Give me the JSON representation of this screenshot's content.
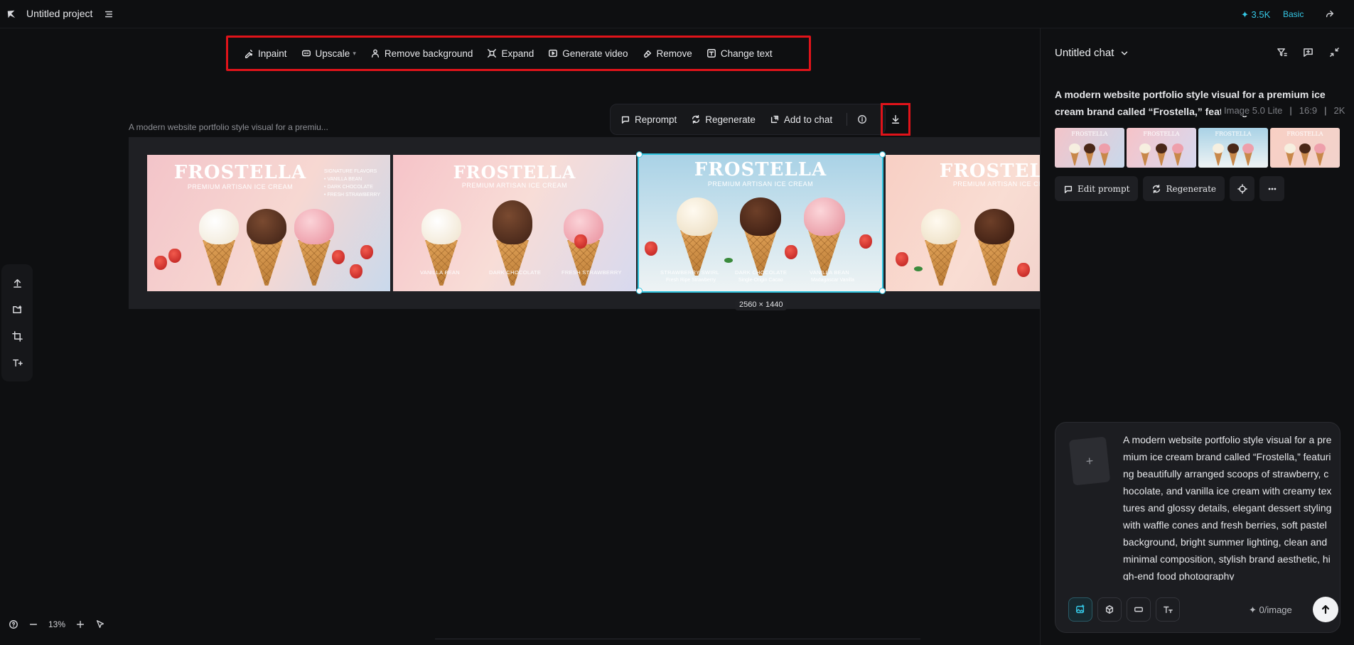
{
  "header": {
    "project_title": "Untitled project",
    "credits": "✦ 3.5K",
    "plan": "Basic"
  },
  "toolbar": {
    "items": [
      {
        "label": "Inpaint",
        "icon": "inpaint-icon"
      },
      {
        "label": "Upscale",
        "icon": "upscale-icon"
      },
      {
        "label": "Remove background",
        "icon": "person-icon"
      },
      {
        "label": "Expand",
        "icon": "expand-icon"
      },
      {
        "label": "Generate video",
        "icon": "video-icon"
      },
      {
        "label": "Remove",
        "icon": "eraser-icon"
      },
      {
        "label": "Change text",
        "icon": "text-icon"
      }
    ]
  },
  "image_actions": {
    "reprompt": "Reprompt",
    "regenerate": "Regenerate",
    "add_to_chat": "Add to chat"
  },
  "canvas": {
    "caption": "A modern website portfolio style visual for a premiu...",
    "dimensions": "2560 × 1440",
    "zoom": "13%",
    "images": [
      {
        "title": "FROSTELLA",
        "subtitle": "PREMIUM ARTISAN ICE CREAM",
        "signature": [
          "SIGNATURE FLAVORS",
          "• VANILLA BEAN",
          "• DARK CHOCOLATE",
          "• FRESH STRAWBERRY"
        ]
      },
      {
        "title": "FROSTELLA",
        "subtitle": "PREMIUM ARTISAN ICE CREAM",
        "flavors": [
          "VANILLA BEAN",
          "DARK CHOCOLATE",
          "FRESH STRAWBERRY"
        ]
      },
      {
        "title": "FROSTELLA",
        "subtitle": "PREMIUM ARTISAN ICE CREAM",
        "flavors": [
          "STRAWBERRY SWIRL",
          "DARK CHOCOLATE",
          "VANILLA BEAN"
        ],
        "details": [
          "Fresh Ripe Strawberry",
          "Single-Origin Cacao",
          "Madagascar Vanilla"
        ]
      },
      {
        "title": "FROSTELLA",
        "subtitle": "PREMIUM ARTISAN ICE CREAM"
      }
    ]
  },
  "chat": {
    "title": "Untitled chat",
    "prompt_preview": "A modern website portfolio style visual for a premium ice cream brand called “Frostella,” featuring",
    "model": "Image 5.0 Lite",
    "ratio": "16:9",
    "resolution": "2K",
    "thumb_label": "FROSTELLA",
    "edit_prompt": "Edit prompt",
    "regenerate": "Regenerate",
    "composer_text": "A modern website portfolio style visual for a premium ice cream brand called “Frostella,” featuring beautifully arranged scoops of strawberry, chocolate, and vanilla ice cream with creamy textures and glossy details, elegant dessert styling with waffle cones and fresh berries, soft pastel background, bright summer lighting, clean and minimal composition, stylish brand aesthetic, high-end food photography",
    "cost": "✦ 0/image"
  },
  "colors": {
    "accent": "#35c8e6",
    "highlight_box": "#e0131a",
    "background": "#0e0f11"
  }
}
